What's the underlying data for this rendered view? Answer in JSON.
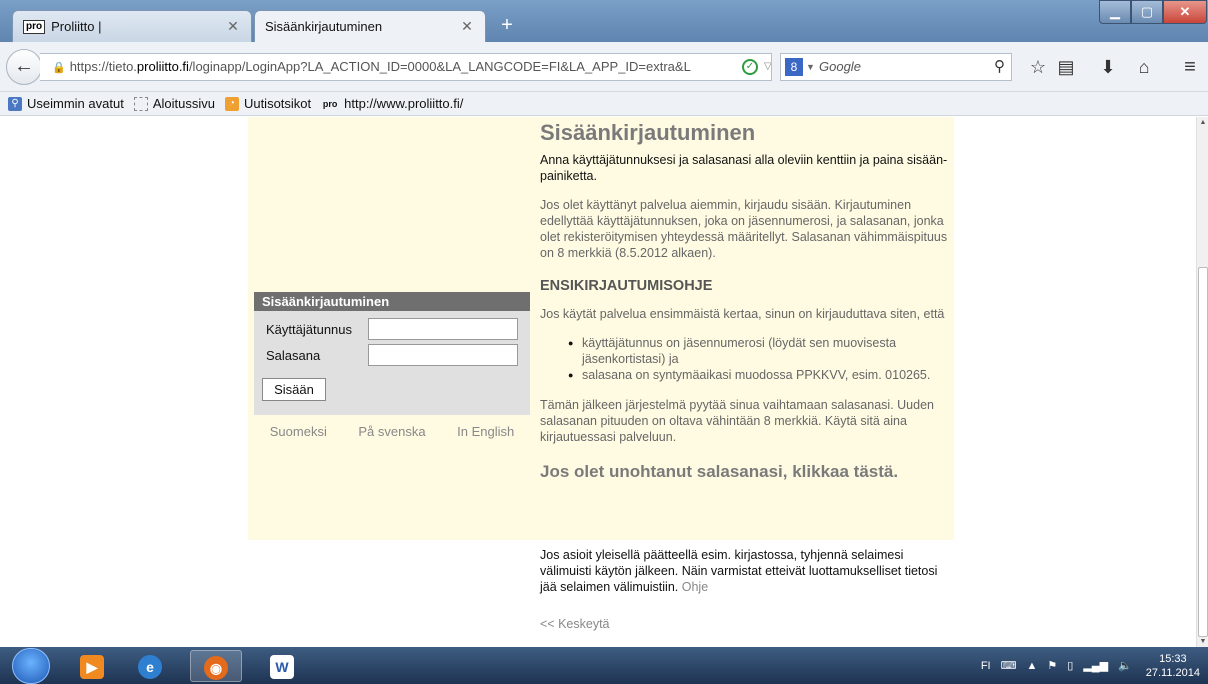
{
  "browser": {
    "tabs": [
      {
        "label": "Proliitto |",
        "favicon": "pro"
      },
      {
        "label": "Sisäänkirjautuminen"
      }
    ],
    "new_tab": "+",
    "url_prefix": "https://tieto.",
    "url_host": "proliitto.fi",
    "url_path": "/loginapp/LoginApp?LA_ACTION_ID=0000&LA_LANGCODE=FI&LA_APP_ID=extra&L",
    "search_placeholder": "Google",
    "search_engine_icon": "8",
    "bookmarks": [
      {
        "label": "Useimmin avatut",
        "icon": "most-visited-icon"
      },
      {
        "label": "Aloitussivu",
        "icon": "start-page-icon"
      },
      {
        "label": "Uutisotsikot",
        "icon": "rss-icon"
      },
      {
        "label": "http://www.proliitto.fi/",
        "icon": "pro"
      }
    ]
  },
  "login": {
    "box_title": "Sisäänkirjautuminen",
    "username_label": "Käyttäjätunnus",
    "username_value": "",
    "password_label": "Salasana",
    "password_value": "",
    "submit_label": "Sisään",
    "languages": [
      "Suomeksi",
      "På svenska",
      "In English"
    ]
  },
  "content": {
    "title": "Sisäänkirjautuminen",
    "intro": "Anna käyttäjätunnuksesi ja salasanasi alla oleviin kenttiin ja paina sisään-painiketta.",
    "info": "Jos olet käyttänyt palvelua aiemmin, kirjaudu sisään. Kirjautuminen edellyttää käyttäjätunnuksen, joka on jäsennumerosi, ja salasanan, jonka olet rekisteröitymisen yhteydessä määritellyt. Salasanan vähimmäispituus on 8 merkkiä (8.5.2012 alkaen).",
    "instructions_heading": "ENSIKIRJAUTUMISOHJE",
    "first_time": "Jos käytät palvelua ensimmäistä kertaa, sinun on kirjauduttava siten, että",
    "bullets": [
      "käyttäjätunnus on jäsennumerosi (löydät sen muovisesta jäsenkortistasi) ja",
      "salasana on syntymäaikasi muodossa PPKKVV, esim. 010265."
    ],
    "after": "Tämän jälkeen järjestelmä pyytää sinua vaihtamaan salasanasi. Uuden salasanan pituuden on oltava vähintään 8 merkkiä. Käytä sitä aina kirjautuessasi palveluun.",
    "forgot_link": "Jos olet unohtanut salasanasi, klikkaa tästä.",
    "security_note": "Jos asioit yleisellä päätteellä esim. kirjastossa, tyhjennä selaimesi välimuisti käytön jälkeen. Näin varmistat etteivät luottamukselliset tietosi jää selaimen välimuistiin.",
    "help_link": "Ohje",
    "cancel_link": "<< Keskeytä"
  },
  "taskbar": {
    "keyboard_lang": "FI",
    "time": "15:33",
    "date": "27.11.2014"
  },
  "colors": {
    "page_panel": "#fffbe2",
    "login_header": "#6f6f6f",
    "login_box": "#e0e0e0",
    "link_gray": "#888888"
  }
}
